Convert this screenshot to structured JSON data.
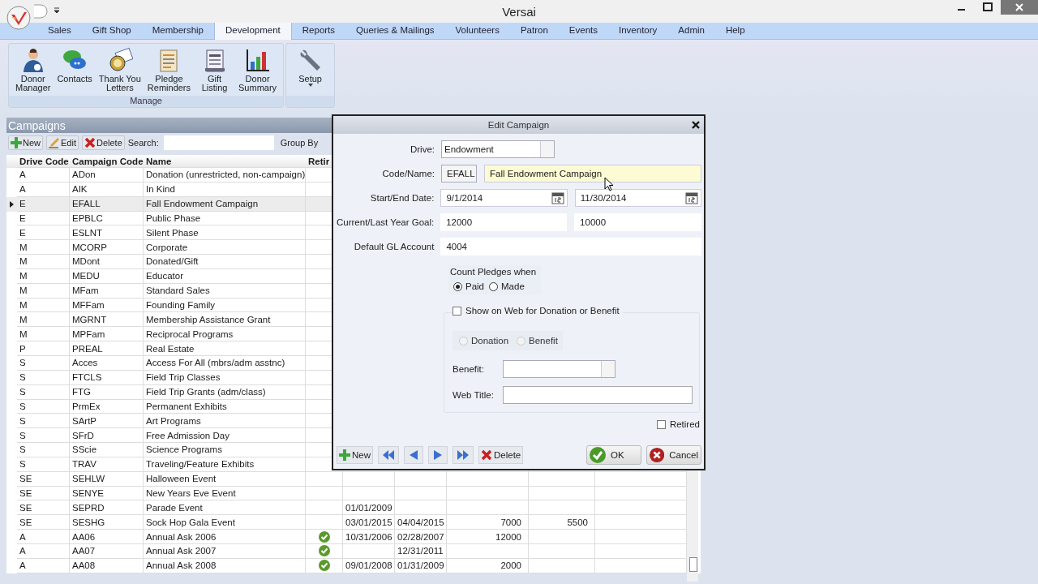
{
  "window": {
    "title": "Versai"
  },
  "ribbon": {
    "tabs": [
      {
        "label": "Sales",
        "selected": false
      },
      {
        "label": "Gift Shop",
        "selected": false
      },
      {
        "label": "Membership",
        "selected": false
      },
      {
        "label": "Development",
        "selected": true
      },
      {
        "label": "Reports",
        "selected": false
      },
      {
        "label": "Queries & Mailings",
        "selected": false
      },
      {
        "label": "Volunteers",
        "selected": false
      },
      {
        "label": "Patron",
        "selected": false
      },
      {
        "label": "Events",
        "selected": false
      },
      {
        "label": "Inventory",
        "selected": false
      },
      {
        "label": "Admin",
        "selected": false
      },
      {
        "label": "Help",
        "selected": false
      }
    ],
    "groups": [
      {
        "label": "Manage",
        "buttons": [
          {
            "kind": "person",
            "label": "Donor\nManager"
          },
          {
            "kind": "chat",
            "label": "Contacts"
          },
          {
            "kind": "letter",
            "label": "Thank You\nLetters"
          },
          {
            "kind": "reminder",
            "label": "Pledge\nReminders"
          },
          {
            "kind": "listing",
            "label": "Gift\nListing"
          },
          {
            "kind": "chart",
            "label": "Donor\nSummary"
          }
        ]
      },
      {
        "buttons": [
          {
            "kind": "wrench",
            "label": "Setup",
            "dropdown": true
          }
        ]
      }
    ]
  },
  "panel": {
    "title": "Campaigns",
    "toolbar": [
      {
        "kind": "new",
        "label": "New"
      },
      {
        "kind": "edit",
        "label": "Edit"
      },
      {
        "kind": "delete",
        "label": "Delete"
      }
    ],
    "search_label": "Search:",
    "group_by_label": "Group By"
  },
  "table": {
    "columns": [
      "Drive Code",
      "Campaign Code",
      "Name",
      "Retir"
    ],
    "rows": [
      {
        "drive": "A",
        "code": "ADon",
        "name": "Donation (unrestricted, non-campaign)",
        "retired": false,
        "selected": false
      },
      {
        "drive": "A",
        "code": "AIK",
        "name": "In Kind",
        "retired": false,
        "selected": false
      },
      {
        "drive": "E",
        "code": "EFALL",
        "name": "Fall Endowment Campaign",
        "retired": false,
        "selected": true
      },
      {
        "drive": "E",
        "code": "EPBLC",
        "name": "Public Phase",
        "retired": false,
        "selected": false
      },
      {
        "drive": "E",
        "code": "ESLNT",
        "name": "Silent Phase",
        "retired": false,
        "selected": false
      },
      {
        "drive": "M",
        "code": "MCORP",
        "name": "Corporate",
        "retired": false,
        "selected": false
      },
      {
        "drive": "M",
        "code": "MDont",
        "name": "Donated/Gift",
        "retired": false,
        "selected": false
      },
      {
        "drive": "M",
        "code": "MEDU",
        "name": "Educator",
        "retired": false,
        "selected": false
      },
      {
        "drive": "M",
        "code": "MFam",
        "name": "Standard Sales",
        "retired": false,
        "selected": false
      },
      {
        "drive": "M",
        "code": "MFFam",
        "name": "Founding Family",
        "retired": false,
        "selected": false
      },
      {
        "drive": "M",
        "code": "MGRNT",
        "name": "Membership Assistance Grant",
        "retired": false,
        "selected": false
      },
      {
        "drive": "M",
        "code": "MPFam",
        "name": "Reciprocal Programs",
        "retired": false,
        "selected": false
      },
      {
        "drive": "P",
        "code": "PREAL",
        "name": "Real Estate",
        "retired": false,
        "selected": false
      },
      {
        "drive": "S",
        "code": "Acces",
        "name": "Access For All (mbrs/adm asstnc)",
        "retired": false,
        "selected": false
      },
      {
        "drive": "S",
        "code": "FTCLS",
        "name": "Field Trip Classes",
        "retired": false,
        "selected": false
      },
      {
        "drive": "S",
        "code": "FTG",
        "name": "Field Trip Grants (adm/class)",
        "retired": false,
        "selected": false
      },
      {
        "drive": "S",
        "code": "PrmEx",
        "name": "Permanent Exhibits",
        "retired": false,
        "selected": false
      },
      {
        "drive": "S",
        "code": "SArtP",
        "name": "Art Programs",
        "retired": false,
        "selected": false
      },
      {
        "drive": "S",
        "code": "SFrD",
        "name": "Free Admission Day",
        "retired": false,
        "selected": false
      },
      {
        "drive": "S",
        "code": "SScie",
        "name": "Science Programs",
        "retired": false,
        "selected": false
      },
      {
        "drive": "S",
        "code": "TRAV",
        "name": "Traveling/Feature Exhibits",
        "retired": false,
        "selected": false
      },
      {
        "drive": "SE",
        "code": "SEHLW",
        "name": "Halloween Event",
        "retired": false,
        "selected": false
      },
      {
        "drive": "SE",
        "code": "SENYE",
        "name": "New Years Eve Event",
        "retired": false,
        "selected": false
      },
      {
        "drive": "SE",
        "code": "SEPRD",
        "name": "Parade Event",
        "retired": false,
        "selected": false,
        "start": "01/01/2009"
      },
      {
        "drive": "SE",
        "code": "SESHG",
        "name": "Sock Hop Gala Event",
        "retired": false,
        "selected": false,
        "start": "03/01/2015",
        "end": "04/04/2015",
        "goal": "7000",
        "last_goal": "5500"
      },
      {
        "drive": "A",
        "code": "AA06",
        "name": "Annual Ask 2006",
        "retired": true,
        "selected": false,
        "start": "10/31/2006",
        "end": "02/28/2007",
        "goal": "12000"
      },
      {
        "drive": "A",
        "code": "AA07",
        "name": "Annual Ask 2007",
        "retired": true,
        "selected": false,
        "end": "12/31/2011"
      },
      {
        "drive": "A",
        "code": "AA08",
        "name": "Annual Ask 2008",
        "retired": true,
        "selected": false,
        "start": "09/01/2008",
        "end": "01/31/2009",
        "goal": "2000"
      }
    ]
  },
  "dialog": {
    "title": "Edit Campaign",
    "drive": {
      "label": "Drive:",
      "value": "Endowment"
    },
    "code_name": {
      "label": "Code/Name:",
      "code": "EFALL",
      "name": "Fall Endowment Campaign",
      "focused": true
    },
    "dates": {
      "label": "Start/End Date:",
      "start": "9/1/2014",
      "end": "11/30/2014"
    },
    "goals": {
      "label": "Current/Last Year Goal:",
      "current": "12000",
      "last": "10000"
    },
    "gl_account": {
      "label": "Default GL Account",
      "value": "4004"
    },
    "count_pledges": {
      "label": "Count Pledges when",
      "options": [
        {
          "label": "Paid",
          "selected": true
        },
        {
          "label": "Made",
          "selected": false
        }
      ]
    },
    "show_on_web": {
      "label": "Show on Web for Donation or Benefit",
      "checked": false,
      "options": [
        {
          "label": "Donation",
          "selected": false
        },
        {
          "label": "Benefit",
          "selected": false
        }
      ],
      "benefit_label": "Benefit:",
      "web_title_label": "Web Title:"
    },
    "retired": {
      "label": "Retired",
      "checked": false
    },
    "nav_buttons": [
      {
        "kind": "new",
        "label": "New"
      },
      {
        "kind": "first"
      },
      {
        "kind": "prev"
      },
      {
        "kind": "next"
      },
      {
        "kind": "last"
      },
      {
        "kind": "delete",
        "label": "Delete"
      }
    ],
    "ok": "OK",
    "cancel": "Cancel"
  }
}
